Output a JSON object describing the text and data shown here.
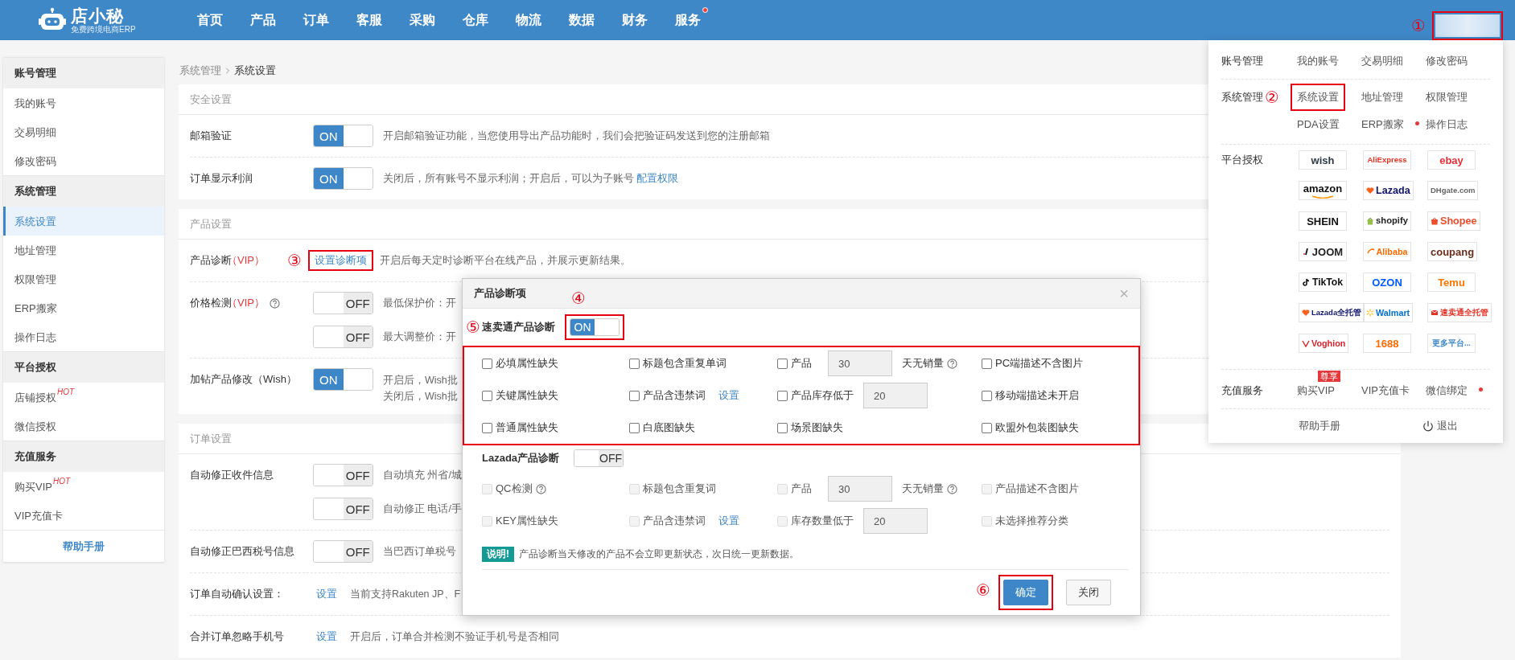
{
  "header": {
    "logo": {
      "name": "店小秘",
      "tagline": "免费跨境电商ERP"
    },
    "nav": [
      {
        "label": "首页",
        "dot": false
      },
      {
        "label": "产品",
        "dot": false
      },
      {
        "label": "订单",
        "dot": false
      },
      {
        "label": "客服",
        "dot": false
      },
      {
        "label": "采购",
        "dot": false
      },
      {
        "label": "仓库",
        "dot": false
      },
      {
        "label": "物流",
        "dot": false
      },
      {
        "label": "数据",
        "dot": false
      },
      {
        "label": "财务",
        "dot": false
      },
      {
        "label": "服务",
        "dot": true
      }
    ],
    "account": {
      "marker": "①",
      "highlighted": true
    }
  },
  "sidebar": {
    "groups": [
      {
        "title": "账号管理",
        "items": [
          {
            "label": "我的账号",
            "selected": false
          },
          {
            "label": "交易明细",
            "selected": false
          },
          {
            "label": "修改密码",
            "selected": false
          }
        ]
      },
      {
        "title": "系统管理",
        "items": [
          {
            "label": "系统设置",
            "selected": true
          },
          {
            "label": "地址管理",
            "selected": false
          },
          {
            "label": "权限管理",
            "selected": false
          },
          {
            "label": "ERP搬家",
            "selected": false
          },
          {
            "label": "操作日志",
            "selected": false
          }
        ]
      },
      {
        "title": "平台授权",
        "items": [
          {
            "label": "店铺授权",
            "hot": "HOT",
            "selected": false
          },
          {
            "label": "微信授权",
            "selected": false
          }
        ]
      },
      {
        "title": "充值服务",
        "items": [
          {
            "label": "购买VIP",
            "hot": "HOT",
            "selected": false
          },
          {
            "label": "VIP充值卡",
            "selected": false
          }
        ]
      }
    ],
    "help": "帮助手册"
  },
  "breadcrumb": [
    "系统管理",
    "系统设置"
  ],
  "sections": [
    {
      "title": "安全设置",
      "rows": [
        {
          "label": "邮箱验证",
          "controls": [
            {
              "kind": "toggle",
              "on": true,
              "label": "ON",
              "desc": [
                "开启邮箱验证功能，当您使用导出产品功能时，我们会把验证码发送到您的注册邮箱"
              ]
            }
          ]
        },
        {
          "label": "订单显示利润",
          "controls": [
            {
              "kind": "toggle",
              "on": true,
              "label": "ON",
              "desc": [
                "关闭后，所有账号不显示利润；开启后，可以为子账号"
              ],
              "link": "配置权限"
            }
          ]
        }
      ]
    },
    {
      "title": "产品设置",
      "rows": [
        {
          "label": "产品诊断",
          "vip": "（VIP）",
          "controls": [
            {
              "kind": "link",
              "text": "设置诊断项",
              "marker": "③",
              "highlighted": true,
              "desc": [
                "开启后每天定时诊断平台在线产品，并展示更新结果。"
              ]
            }
          ]
        },
        {
          "label": "价格检测",
          "vip": "（VIP）",
          "help": true,
          "controls": [
            {
              "kind": "toggle",
              "on": false,
              "label": "OFF",
              "desc": [
                "最低保护价：开"
              ]
            },
            {
              "kind": "toggle",
              "on": false,
              "label": "OFF",
              "desc": [
                "最大调整价：开"
              ]
            }
          ]
        },
        {
          "label": "加钻产品修改（Wish）",
          "controls": [
            {
              "kind": "toggle",
              "on": true,
              "label": "ON",
              "desc": [
                "开启后，Wish批",
                "关闭后，Wish批"
              ]
            }
          ]
        }
      ]
    },
    {
      "title": "订单设置",
      "rows": [
        {
          "label": "自动修正收件信息",
          "controls": [
            {
              "kind": "toggle",
              "on": false,
              "label": "OFF",
              "desc": [
                "自动填充 州省/城"
              ]
            },
            {
              "kind": "toggle",
              "on": false,
              "label": "OFF",
              "desc": [
                "自动修正 电话/手"
              ]
            }
          ]
        },
        {
          "label": "自动修正巴西税号信息",
          "controls": [
            {
              "kind": "toggle",
              "on": false,
              "label": "OFF",
              "desc": [
                "当巴西订单税号"
              ]
            }
          ]
        },
        {
          "label": "订单自动确认设置：",
          "controls": [
            {
              "kind": "link",
              "text": "设置",
              "desc": [
                "当前支持Rakuten JP、F"
              ]
            }
          ]
        },
        {
          "label": "合并订单忽略手机号",
          "controls": [
            {
              "kind": "link",
              "text": "设置",
              "desc": [
                "开启后，订单合并检测不验证手机号是否相同"
              ]
            }
          ]
        }
      ]
    }
  ],
  "menu": {
    "rows": [
      {
        "title": "账号管理",
        "links": [
          {
            "label": "我的账号",
            "dot": false
          },
          {
            "label": "交易明细",
            "dot": false
          },
          {
            "label": "修改密码",
            "dot": false
          }
        ]
      },
      {
        "title": "系统管理",
        "marker": "②",
        "links": [
          {
            "label": "系统设置",
            "dot": false,
            "highlighted": true
          },
          {
            "label": "地址管理",
            "dot": false
          },
          {
            "label": "权限管理",
            "dot": false
          },
          {
            "label": "PDA设置",
            "dot": false
          },
          {
            "label": "ERP搬家",
            "dot": true
          },
          {
            "label": "操作日志",
            "dot": false
          }
        ]
      },
      {
        "title": "平台授权",
        "platforms": [
          {
            "name": "wish",
            "color": "#2b3a44",
            "kind": "text"
          },
          {
            "name": "AliExpress",
            "color": "#e43225",
            "kind": "text"
          },
          {
            "name": "ebay",
            "color": "#e53238",
            "kind": "text"
          },
          {
            "name": "amazon",
            "color": "#111111",
            "kind": "smile"
          },
          {
            "name": "Lazada",
            "color": "#0f146d",
            "kind": "heart"
          },
          {
            "name": "DHgate.com",
            "color": "#666666",
            "kind": "text"
          },
          {
            "name": "SHEIN",
            "color": "#111111",
            "kind": "text"
          },
          {
            "name": "shopify",
            "color": "#222222",
            "kind": "green-bag"
          },
          {
            "name": "Shopee",
            "color": "#ee4d2d",
            "kind": "orange-bag"
          },
          {
            "name": "JOOM",
            "color": "#222222",
            "kind": "bar"
          },
          {
            "name": "Alibaba",
            "color": "#ff6a00",
            "kind": "swoosh"
          },
          {
            "name": "coupang",
            "color": "#6b2d1c",
            "kind": "text"
          },
          {
            "name": "TikTok",
            "color": "#111111",
            "kind": "note"
          },
          {
            "name": "OZON",
            "color": "#005bff",
            "kind": "text"
          },
          {
            "name": "Temu",
            "color": "#fb7701",
            "kind": "text"
          },
          {
            "name": "Lazada全托管",
            "color": "#0f146d",
            "kind": "heart"
          },
          {
            "name": "Walmart",
            "color": "#0071ce",
            "kind": "spark"
          },
          {
            "name": "速卖通全托管",
            "color": "#e43225",
            "kind": "envelope"
          },
          {
            "name": "Voghion",
            "color": "#d9232d",
            "kind": "v-mark"
          },
          {
            "name": "1688",
            "color": "#ff6a00",
            "kind": "text"
          },
          {
            "name": "更多平台...",
            "color": "#3d87c9",
            "kind": "text"
          }
        ]
      },
      {
        "title": "充值服务",
        "links": [
          {
            "label": "购买VIP",
            "dot": false,
            "badge": "尊享"
          },
          {
            "label": "VIP充值卡",
            "dot": false
          },
          {
            "label": "微信绑定",
            "dot": true
          }
        ]
      }
    ],
    "help": "帮助手册",
    "logout": "退出"
  },
  "dialog": {
    "title": "产品诊断项",
    "close": "×",
    "sections": [
      {
        "title": "速卖通产品诊断",
        "marker": "⑤",
        "highlighted": true,
        "toggle": {
          "on": true,
          "label": "ON",
          "marker": "④",
          "highlighted": true
        },
        "items": [
          {
            "kind": "plain",
            "label": "必填属性缺失",
            "checked": false,
            "disabled": false
          },
          {
            "kind": "plain",
            "label": "标题包含重复单词",
            "checked": false,
            "disabled": false
          },
          {
            "kind": "days",
            "label": "产品",
            "value": "30",
            "suffix": "天无销量",
            "checked": false,
            "disabled": false
          },
          {
            "kind": "plain",
            "label": "PC端描述不含图片",
            "checked": false,
            "disabled": false
          },
          {
            "kind": "plain",
            "label": "关键属性缺失",
            "checked": false,
            "disabled": false
          },
          {
            "kind": "link",
            "label": "产品含违禁词",
            "link": "设置",
            "checked": false,
            "disabled": false
          },
          {
            "kind": "input",
            "label": "产品库存低于",
            "value": "20",
            "checked": false,
            "disabled": false
          },
          {
            "kind": "plain",
            "label": "移动端描述未开启",
            "checked": false,
            "disabled": false
          },
          {
            "kind": "plain",
            "label": "普通属性缺失",
            "checked": false,
            "disabled": false
          },
          {
            "kind": "plain",
            "label": "白底图缺失",
            "checked": false,
            "disabled": false
          },
          {
            "kind": "plain",
            "label": "场景图缺失",
            "checked": false,
            "disabled": false
          },
          {
            "kind": "plain",
            "label": "欧盟外包装图缺失",
            "checked": false,
            "disabled": false
          }
        ]
      },
      {
        "title": "Lazada产品诊断",
        "toggle": {
          "on": false,
          "label": "OFF"
        },
        "items": [
          {
            "kind": "help",
            "label": "QC检测",
            "checked": false,
            "disabled": true
          },
          {
            "kind": "plain",
            "label": "标题包含重复词",
            "checked": false,
            "disabled": true
          },
          {
            "kind": "days",
            "label": "产品",
            "value": "30",
            "suffix": "天无销量",
            "checked": false,
            "disabled": true
          },
          {
            "kind": "plain",
            "label": "产品描述不含图片",
            "checked": false,
            "disabled": true
          },
          {
            "kind": "plain",
            "label": "KEY属性缺失",
            "checked": false,
            "disabled": true
          },
          {
            "kind": "link",
            "label": "产品含违禁词",
            "link": "设置",
            "checked": false,
            "disabled": true
          },
          {
            "kind": "input",
            "label": "库存数量低于",
            "value": "20",
            "checked": false,
            "disabled": true
          },
          {
            "kind": "plain",
            "label": "未选择推荐分类",
            "checked": false,
            "disabled": true
          }
        ]
      }
    ],
    "note": {
      "tag": "说明!",
      "text": "产品诊断当天修改的产品不会立即更新状态，次日统一更新数据。"
    },
    "buttons": [
      {
        "label": "确定",
        "kind": "primary",
        "marker": "⑥",
        "highlighted": true
      },
      {
        "label": "关闭",
        "kind": "default"
      }
    ]
  }
}
